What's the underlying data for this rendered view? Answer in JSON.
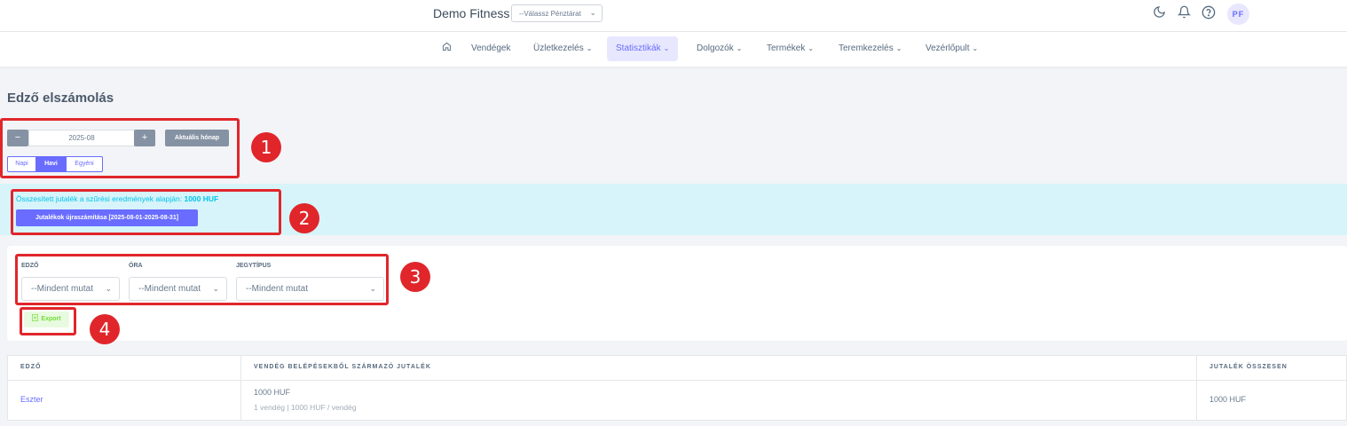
{
  "topbar": {
    "brand": "Demo Fitness",
    "register_select": "--Válassz Pénztárat",
    "icons": [
      "moon-icon",
      "bell-icon",
      "help-icon"
    ],
    "avatar_initials": "PF"
  },
  "nav": {
    "items": [
      {
        "label": "",
        "icon": "home-icon"
      },
      {
        "label": "Vendégek",
        "has_dropdown": false
      },
      {
        "label": "Üzletkezelés",
        "has_dropdown": true
      },
      {
        "label": "Statisztikák",
        "has_dropdown": true,
        "active": true
      },
      {
        "label": "Dolgozók",
        "has_dropdown": true
      },
      {
        "label": "Termékek",
        "has_dropdown": true
      },
      {
        "label": "Teremkezelés",
        "has_dropdown": true
      },
      {
        "label": "Vezérlőpult",
        "has_dropdown": true
      }
    ]
  },
  "page": {
    "title": "Edző elszámolás"
  },
  "period": {
    "minus": "−",
    "value": "2025-08",
    "plus": "+",
    "current_month": "Aktuális hónap",
    "modes": [
      "Napi",
      "Havi",
      "Egyéni"
    ],
    "active_mode": "Havi"
  },
  "summary": {
    "text": "Összesített jutalék a szűrési eredmények alapján:",
    "amount": "1000 HUF",
    "recalc_button": "Jutalékok újraszámítása [2025-08-01-2025-08-31]"
  },
  "filters": {
    "trainer": {
      "label": "EDZŐ",
      "value": "--Mindent mutat"
    },
    "class": {
      "label": "ÓRA",
      "value": "--Mindent mutat"
    },
    "ticket_type": {
      "label": "JEGYTÍPUS",
      "value": "--Mindent mutat"
    },
    "export": "Export"
  },
  "table": {
    "headers": [
      "EDZŐ",
      "VENDÉG BELÉPÉSEKBŐL SZÁRMAZÓ JUTALÉK",
      "JUTALÉK ÖSSZESEN"
    ],
    "rows": [
      {
        "trainer": "Eszter",
        "commission": "1000 HUF",
        "detail": "1 vendég | 1000 HUF / vendég",
        "total": "1000 HUF"
      }
    ]
  },
  "annotations": [
    "1",
    "2",
    "3",
    "4"
  ],
  "colors": {
    "primary": "#696cff",
    "secondary": "#8592a3",
    "info_bg": "#d6f4f9",
    "info_text": "#03c3ec",
    "success_text": "#71dd37",
    "annotation": "#e0262b"
  }
}
